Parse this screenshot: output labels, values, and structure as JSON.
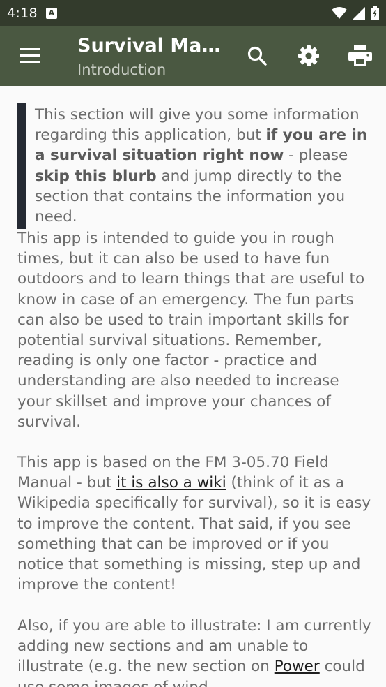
{
  "status_bar": {
    "time": "4:18",
    "notification_icon": "A",
    "icons": [
      "wifi-icon",
      "signal-icon",
      "battery-icon"
    ]
  },
  "app_bar": {
    "title": "Survival Man...",
    "subtitle": "Introduction",
    "actions": [
      "search-icon",
      "gear-icon",
      "print-icon"
    ]
  },
  "content": {
    "quote": {
      "t1": "This section will give you some information regarding this application, but ",
      "b1": "if you are in a survival situation right now",
      "t2": " - please ",
      "b2": "skip this blurb",
      "t3": " and jump directly to the section that contains the information you need."
    },
    "p1": "This app is intended to guide you in rough times, but it can also be used to have fun outdoors and to learn things that are useful to know in case of an emergency. The fun parts can also be used to train important skills for potential survival situations. Remember, reading is only one factor - practice and understanding are also needed to increase your skillset and improve your chances of survival.",
    "p2": {
      "t1": "This app is based on the FM 3-05.70 Field Manual - but ",
      "link": "it is also a wiki",
      "t2": " (think of it as a Wikipedia specifically for survival), so it is easy to improve the content. That said, if you see something that can be improved or if you notice that something is missing, step up and improve the content!"
    },
    "p3": {
      "t1": "Also, if you are able to illustrate: I am currently adding new sections and am unable to illustrate (e.g. the new section on ",
      "link": "Power",
      "t2": " could use some images of wind"
    }
  },
  "colors": {
    "status_bar": "#333b2c",
    "app_bar": "#4a5841",
    "background": "#fafafa",
    "quote_bar": "#252a33",
    "body_text": "#6b6b6b"
  }
}
